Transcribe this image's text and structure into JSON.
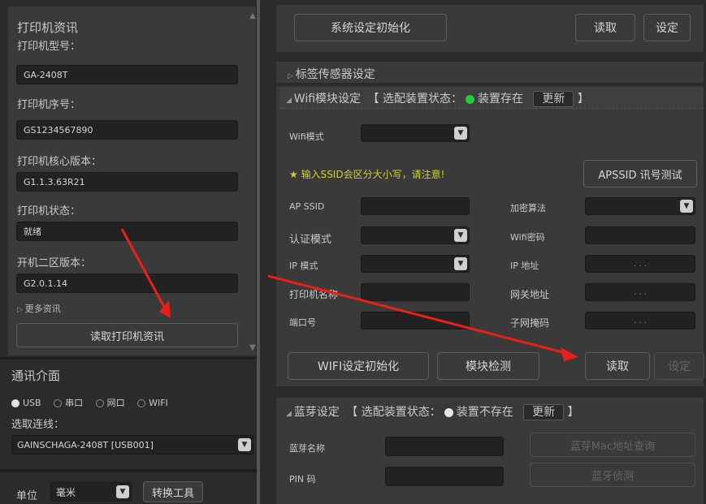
{
  "printer_info": {
    "title": "打印机资讯",
    "model_label": "打印机型号：",
    "model_value": "GA-2408T",
    "serial_label": "打印机序号：",
    "serial_value": "GS1234567890",
    "core_label": "打印机核心版本：",
    "core_value": "G1.1.3.63R21",
    "status_label": "打印机状态：",
    "status_value": "就绪",
    "zone2_label": "开机二区版本：",
    "zone2_value": "G2.0.1.14",
    "more_label": "更多资讯",
    "read_button": "读取打印机资讯"
  },
  "comm": {
    "title": "通讯介面",
    "options": [
      "USB",
      "串口",
      "网口",
      "WIFI"
    ],
    "selected": "USB",
    "conn_label": "选取连线：",
    "conn_value": "GAINSCHAGA-2408T [USB001]"
  },
  "unit": {
    "label": "单位",
    "value": "毫米",
    "convert_button": "转换工具"
  },
  "top": {
    "init_button": "系统设定初始化",
    "read_button": "读取",
    "set_button": "设定"
  },
  "sensor": {
    "title": "标签传感器设定"
  },
  "wifi": {
    "title": "Wifi模块设定",
    "status_prefix": "【 选配装置状态：",
    "status_text": "装置存在",
    "update_button": "更新",
    "status_suffix": "】",
    "mode_label": "Wifi模式",
    "note": "★ 输入SSID会区分大小写，请注意!",
    "apssid_button": "APSSID 讯号测试",
    "ap_ssid_label": "AP SSID",
    "enc_label": "加密算法",
    "auth_label": "认证模式",
    "wifi_pwd_label": "Wifi密码",
    "ip_mode_label": "IP 模式",
    "ip_addr_label": "IP 地址",
    "printer_name_label": "打印机名称",
    "gateway_label": "网关地址",
    "port_label": "端口号",
    "subnet_label": "子网掩码",
    "ip_dots": ".   .   .",
    "init_button": "WIFI设定初始化",
    "detect_button": "模块检测",
    "read_button": "读取",
    "set_button": "设定"
  },
  "bluetooth": {
    "title": "蓝芽设定",
    "status_prefix": "【 选配装置状态：",
    "status_text": "装置不存在",
    "update_button": "更新",
    "status_suffix": "】",
    "name_label": "蓝芽名称",
    "pin_label": "PIN 码",
    "mac_button": "蓝芽Mac地址查询",
    "detect_button": "蓝牙侦测"
  },
  "colors": {
    "arrow": "#e8201c",
    "status_green": "#22cc33"
  }
}
